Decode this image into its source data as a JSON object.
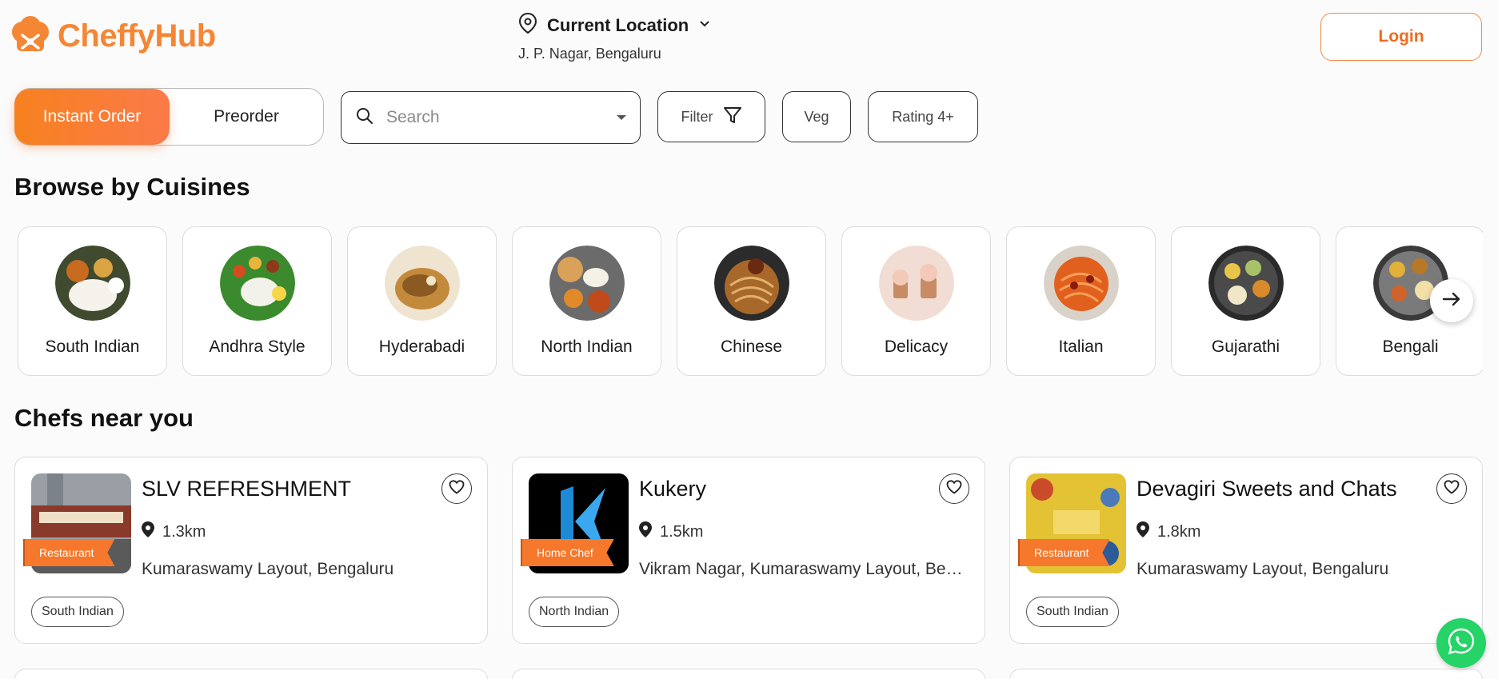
{
  "brand": {
    "name": "CheffyHub",
    "color": "#f58634"
  },
  "location": {
    "title": "Current Location",
    "address": "J. P. Nagar, Bengaluru"
  },
  "header": {
    "login_label": "Login"
  },
  "toolbar": {
    "instant_order_label": "Instant Order",
    "preorder_label": "Preorder",
    "search_placeholder": "Search",
    "filter_label": "Filter",
    "veg_label": "Veg",
    "rating_label": "Rating 4+"
  },
  "sections": {
    "cuisines_title": "Browse by Cuisines",
    "chefs_title": "Chefs near you"
  },
  "cuisines": [
    {
      "name": "South Indian"
    },
    {
      "name": "Andhra Style"
    },
    {
      "name": "Hyderabadi"
    },
    {
      "name": "North Indian"
    },
    {
      "name": "Chinese"
    },
    {
      "name": "Delicacy"
    },
    {
      "name": "Italian"
    },
    {
      "name": "Gujarathi"
    },
    {
      "name": "Bengali"
    }
  ],
  "chefs": [
    {
      "name": "SLV REFRESHMENT",
      "type": "Restaurant",
      "distance": "1.3km",
      "address": "Kumaraswamy Layout, Bengaluru",
      "cuisine": "South Indian"
    },
    {
      "name": "Kukery",
      "type": "Home Chef",
      "distance": "1.5km",
      "address": "Vikram Nagar, Kumaraswamy Layout, Bengaluru",
      "cuisine": "North Indian"
    },
    {
      "name": "Devagiri Sweets and Chats",
      "type": "Restaurant",
      "distance": "1.8km",
      "address": "Kumaraswamy Layout, Bengaluru",
      "cuisine": "South Indian"
    }
  ],
  "colors": {
    "accent": "#f5782c",
    "whatsapp": "#25d366"
  }
}
